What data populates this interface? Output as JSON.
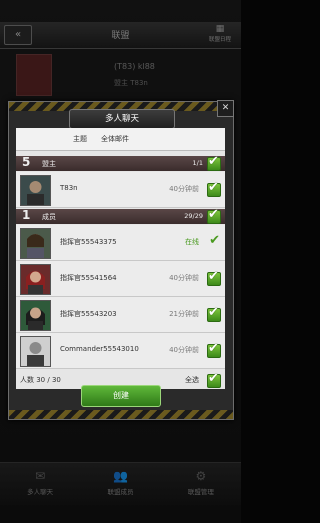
{
  "background": {
    "header_title": "联盟",
    "schedule_label": "联盟日程",
    "alliance_name": "(T83) kl88",
    "leader_line": "盟主 T83n",
    "bottom_tabs": [
      {
        "icon": "mail-icon",
        "label": "多人聊天"
      },
      {
        "icon": "members-icon",
        "label": "联盟成员"
      },
      {
        "icon": "gear-icon",
        "label": "联盟管理"
      }
    ]
  },
  "modal": {
    "title": "多人聊天",
    "subtabs": [
      "主题",
      "全体邮件"
    ],
    "leader_section": {
      "rank": "5",
      "label": "盟主",
      "count": "1/1"
    },
    "leader_row": {
      "name": "T83n",
      "status": "40分钟前",
      "status_type": "offline"
    },
    "members_section": {
      "rank": "1",
      "label": "成员",
      "count": "29/29"
    },
    "member_rows": [
      {
        "name": "指挥官55543375",
        "status": "在线",
        "status_type": "online"
      },
      {
        "name": "指挥官55541564",
        "status": "40分钟前",
        "status_type": "offline"
      },
      {
        "name": "指挥官55543203",
        "status": "21分钟前",
        "status_type": "offline"
      },
      {
        "name": "Commander55543010",
        "status": "40分钟前",
        "status_type": "offline"
      }
    ],
    "footer": {
      "count_label": "人数 30 / 30",
      "select_all_label": "全选"
    },
    "create_label": "创建",
    "accent_green": "#4a9a20"
  }
}
